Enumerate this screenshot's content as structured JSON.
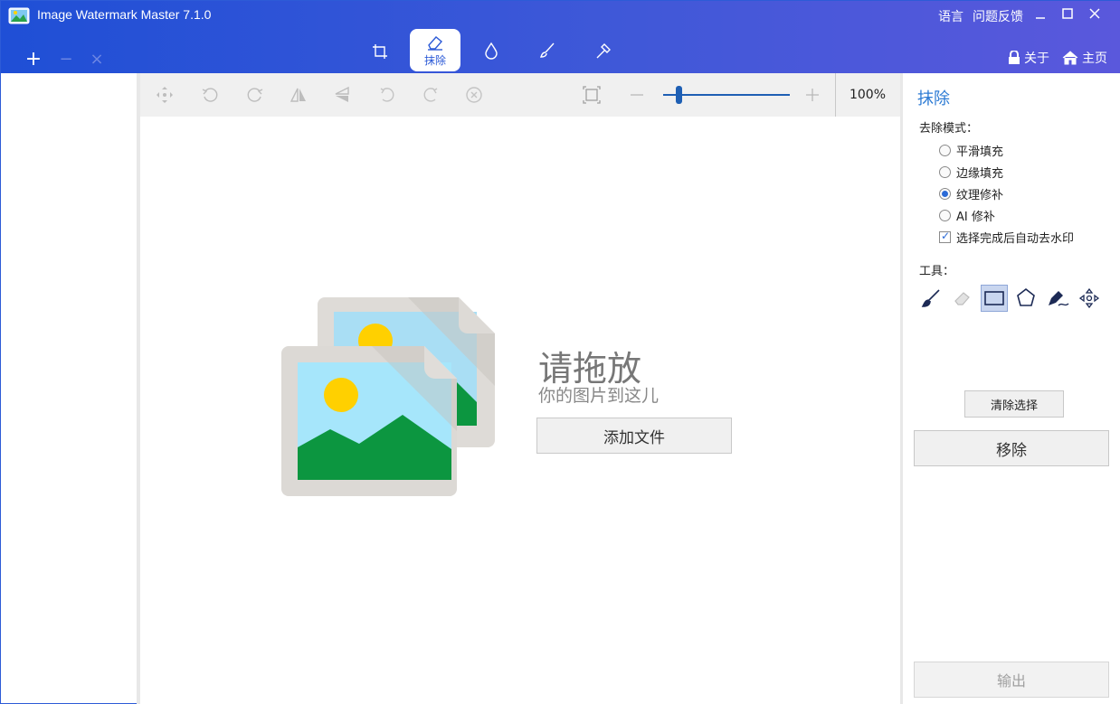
{
  "window": {
    "title": "Image Watermark Master 7.1.0",
    "menu_language": "语言",
    "menu_feedback": "问题反馈",
    "minimize": "—",
    "maximize": "☐",
    "close": "✕"
  },
  "file_actions": {
    "add": "+",
    "remove": "−",
    "clear": "×"
  },
  "tool_tabs": [
    {
      "icon": "crop-icon",
      "label": ""
    },
    {
      "icon": "eraser-icon",
      "label": "抹除",
      "active": true
    },
    {
      "icon": "drop-icon",
      "label": ""
    },
    {
      "icon": "brush-icon",
      "label": ""
    },
    {
      "icon": "magic-wand-icon",
      "label": ""
    }
  ],
  "header_right": {
    "about": "关于",
    "home": "主页"
  },
  "toolbar": {
    "zoom_value": "100%",
    "zoom_level": 0.1
  },
  "canvas": {
    "drop_title": "请拖放",
    "drop_subtitle": "你的图片到这儿",
    "add_file": "添加文件"
  },
  "panel": {
    "title": "抹除",
    "mode_label": "去除模式：",
    "modes": [
      {
        "label": "平滑填充",
        "checked": false
      },
      {
        "label": "边缘填充",
        "checked": false
      },
      {
        "label": "纹理修补",
        "checked": true
      },
      {
        "label": "AI 修补",
        "checked": false
      }
    ],
    "auto_remove": {
      "label": "选择完成后自动去水印",
      "checked": true
    },
    "tools_label": "工具：",
    "tools": [
      "brush-icon",
      "eraser-icon",
      "rectangle-select-icon",
      "polygon-select-icon",
      "pen-icon",
      "move-icon"
    ],
    "clear_selection": "清除选择",
    "remove": "移除",
    "export": "输出"
  },
  "colors": {
    "header_start": "#1f4fd6",
    "header_end": "#5a58dc",
    "accent": "#2d7bd4"
  }
}
